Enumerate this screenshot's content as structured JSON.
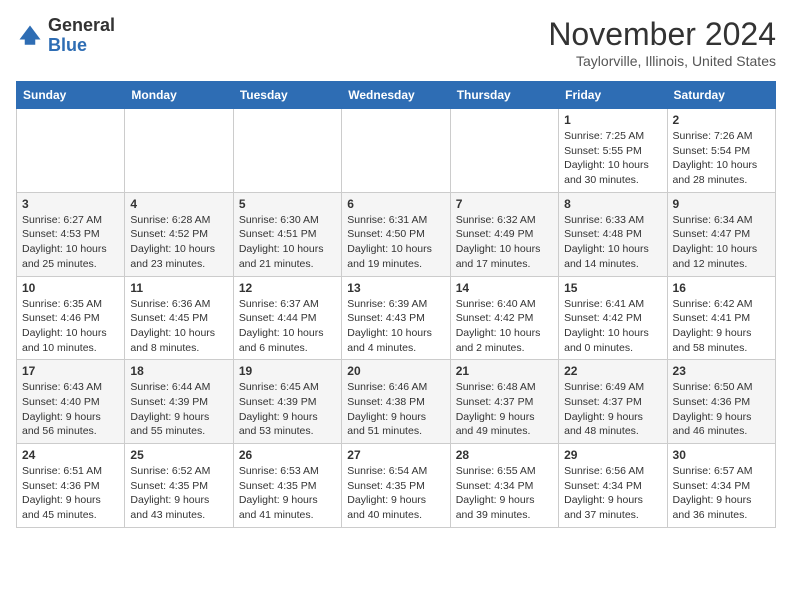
{
  "header": {
    "logo_line1": "General",
    "logo_line2": "Blue",
    "month": "November 2024",
    "location": "Taylorville, Illinois, United States"
  },
  "days_of_week": [
    "Sunday",
    "Monday",
    "Tuesday",
    "Wednesday",
    "Thursday",
    "Friday",
    "Saturday"
  ],
  "weeks": [
    [
      {
        "day": "",
        "info": ""
      },
      {
        "day": "",
        "info": ""
      },
      {
        "day": "",
        "info": ""
      },
      {
        "day": "",
        "info": ""
      },
      {
        "day": "",
        "info": ""
      },
      {
        "day": "1",
        "info": "Sunrise: 7:25 AM\nSunset: 5:55 PM\nDaylight: 10 hours and 30 minutes."
      },
      {
        "day": "2",
        "info": "Sunrise: 7:26 AM\nSunset: 5:54 PM\nDaylight: 10 hours and 28 minutes."
      }
    ],
    [
      {
        "day": "3",
        "info": "Sunrise: 6:27 AM\nSunset: 4:53 PM\nDaylight: 10 hours and 25 minutes."
      },
      {
        "day": "4",
        "info": "Sunrise: 6:28 AM\nSunset: 4:52 PM\nDaylight: 10 hours and 23 minutes."
      },
      {
        "day": "5",
        "info": "Sunrise: 6:30 AM\nSunset: 4:51 PM\nDaylight: 10 hours and 21 minutes."
      },
      {
        "day": "6",
        "info": "Sunrise: 6:31 AM\nSunset: 4:50 PM\nDaylight: 10 hours and 19 minutes."
      },
      {
        "day": "7",
        "info": "Sunrise: 6:32 AM\nSunset: 4:49 PM\nDaylight: 10 hours and 17 minutes."
      },
      {
        "day": "8",
        "info": "Sunrise: 6:33 AM\nSunset: 4:48 PM\nDaylight: 10 hours and 14 minutes."
      },
      {
        "day": "9",
        "info": "Sunrise: 6:34 AM\nSunset: 4:47 PM\nDaylight: 10 hours and 12 minutes."
      }
    ],
    [
      {
        "day": "10",
        "info": "Sunrise: 6:35 AM\nSunset: 4:46 PM\nDaylight: 10 hours and 10 minutes."
      },
      {
        "day": "11",
        "info": "Sunrise: 6:36 AM\nSunset: 4:45 PM\nDaylight: 10 hours and 8 minutes."
      },
      {
        "day": "12",
        "info": "Sunrise: 6:37 AM\nSunset: 4:44 PM\nDaylight: 10 hours and 6 minutes."
      },
      {
        "day": "13",
        "info": "Sunrise: 6:39 AM\nSunset: 4:43 PM\nDaylight: 10 hours and 4 minutes."
      },
      {
        "day": "14",
        "info": "Sunrise: 6:40 AM\nSunset: 4:42 PM\nDaylight: 10 hours and 2 minutes."
      },
      {
        "day": "15",
        "info": "Sunrise: 6:41 AM\nSunset: 4:42 PM\nDaylight: 10 hours and 0 minutes."
      },
      {
        "day": "16",
        "info": "Sunrise: 6:42 AM\nSunset: 4:41 PM\nDaylight: 9 hours and 58 minutes."
      }
    ],
    [
      {
        "day": "17",
        "info": "Sunrise: 6:43 AM\nSunset: 4:40 PM\nDaylight: 9 hours and 56 minutes."
      },
      {
        "day": "18",
        "info": "Sunrise: 6:44 AM\nSunset: 4:39 PM\nDaylight: 9 hours and 55 minutes."
      },
      {
        "day": "19",
        "info": "Sunrise: 6:45 AM\nSunset: 4:39 PM\nDaylight: 9 hours and 53 minutes."
      },
      {
        "day": "20",
        "info": "Sunrise: 6:46 AM\nSunset: 4:38 PM\nDaylight: 9 hours and 51 minutes."
      },
      {
        "day": "21",
        "info": "Sunrise: 6:48 AM\nSunset: 4:37 PM\nDaylight: 9 hours and 49 minutes."
      },
      {
        "day": "22",
        "info": "Sunrise: 6:49 AM\nSunset: 4:37 PM\nDaylight: 9 hours and 48 minutes."
      },
      {
        "day": "23",
        "info": "Sunrise: 6:50 AM\nSunset: 4:36 PM\nDaylight: 9 hours and 46 minutes."
      }
    ],
    [
      {
        "day": "24",
        "info": "Sunrise: 6:51 AM\nSunset: 4:36 PM\nDaylight: 9 hours and 45 minutes."
      },
      {
        "day": "25",
        "info": "Sunrise: 6:52 AM\nSunset: 4:35 PM\nDaylight: 9 hours and 43 minutes."
      },
      {
        "day": "26",
        "info": "Sunrise: 6:53 AM\nSunset: 4:35 PM\nDaylight: 9 hours and 41 minutes."
      },
      {
        "day": "27",
        "info": "Sunrise: 6:54 AM\nSunset: 4:35 PM\nDaylight: 9 hours and 40 minutes."
      },
      {
        "day": "28",
        "info": "Sunrise: 6:55 AM\nSunset: 4:34 PM\nDaylight: 9 hours and 39 minutes."
      },
      {
        "day": "29",
        "info": "Sunrise: 6:56 AM\nSunset: 4:34 PM\nDaylight: 9 hours and 37 minutes."
      },
      {
        "day": "30",
        "info": "Sunrise: 6:57 AM\nSunset: 4:34 PM\nDaylight: 9 hours and 36 minutes."
      }
    ]
  ]
}
